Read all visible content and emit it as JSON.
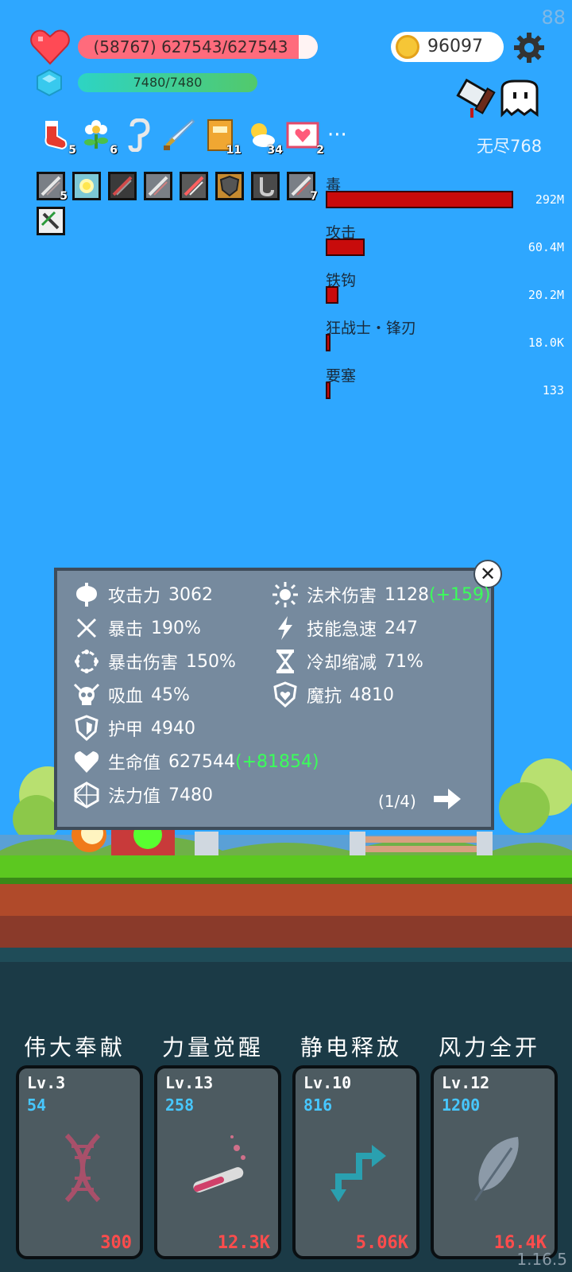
{
  "fps": "88",
  "hp": {
    "text": "(58767) 627543/627543"
  },
  "mp": {
    "text": "7480/7480"
  },
  "gold": "96097",
  "stage": "无尽768",
  "items": [
    {
      "icon": "sock-icon",
      "count": "5"
    },
    {
      "icon": "flower-icon",
      "count": "6"
    },
    {
      "icon": "hook-icon",
      "count": ""
    },
    {
      "icon": "sword-icon",
      "count": ""
    },
    {
      "icon": "book-icon",
      "count": "11"
    },
    {
      "icon": "sun-cloud-icon",
      "count": "34"
    },
    {
      "icon": "heart-card-icon",
      "count": "2"
    }
  ],
  "more": "···",
  "skill_icons": [
    {
      "icon": "blade-skill-icon",
      "count": "5"
    },
    {
      "icon": "light-skill-icon",
      "count": ""
    },
    {
      "icon": "dark-blade-skill-icon",
      "count": ""
    },
    {
      "icon": "blade-skill-icon",
      "count": ""
    },
    {
      "icon": "red-blade-skill-icon",
      "count": ""
    },
    {
      "icon": "shield-skill-icon",
      "count": ""
    },
    {
      "icon": "hook-skill-icon",
      "count": ""
    },
    {
      "icon": "blade-skill-icon",
      "count": "7"
    },
    {
      "icon": "sword-green-skill-icon",
      "count": ""
    }
  ],
  "damage": [
    {
      "name": "毒",
      "value": "292M",
      "ratio": 1.0
    },
    {
      "name": "攻击",
      "value": "60.4M",
      "ratio": 0.207
    },
    {
      "name": "铁钩",
      "value": "20.2M",
      "ratio": 0.069
    },
    {
      "name": "狂战士・锋刃",
      "value": "18.0K",
      "ratio": 0.02
    },
    {
      "name": "要塞",
      "value": "133",
      "ratio": 0.01
    }
  ],
  "stats": {
    "attack": {
      "label": "攻击力",
      "value": "3062"
    },
    "spell": {
      "label": "法术伤害",
      "value": "1128",
      "bonus": "(+159)"
    },
    "crit": {
      "label": "暴击",
      "value": "190%"
    },
    "haste": {
      "label": "技能急速",
      "value": "247"
    },
    "critdmg": {
      "label": "暴击伤害",
      "value": "150%"
    },
    "cdr": {
      "label": "冷却缩减",
      "value": "71%"
    },
    "lifesteal": {
      "label": "吸血",
      "value": "45%"
    },
    "mres": {
      "label": "魔抗",
      "value": "4810"
    },
    "armor": {
      "label": "护甲",
      "value": "4940"
    },
    "life": {
      "label": "生命值",
      "value": "627544",
      "bonus": "(+81854)"
    },
    "mana": {
      "label": "法力值",
      "value": "7480"
    }
  },
  "page": "(1/4)",
  "abilities": [
    {
      "title": "伟大奉献",
      "lv": "Lv.3",
      "num": "54",
      "cost": "300",
      "icon": "dna-icon",
      "color": "#a8506a"
    },
    {
      "title": "力量觉醒",
      "lv": "Lv.13",
      "num": "258",
      "cost": "12.3K",
      "icon": "potion-tube-icon",
      "color": "#d0406a"
    },
    {
      "title": "静电释放",
      "lv": "Lv.10",
      "num": "816",
      "cost": "5.06K",
      "icon": "swap-arrows-icon",
      "color": "#2aa0b0"
    },
    {
      "title": "风力全开",
      "lv": "Lv.12",
      "num": "1200",
      "cost": "16.4K",
      "icon": "feather-icon",
      "color": "#8c9aa8"
    }
  ],
  "version": "1.16.5"
}
